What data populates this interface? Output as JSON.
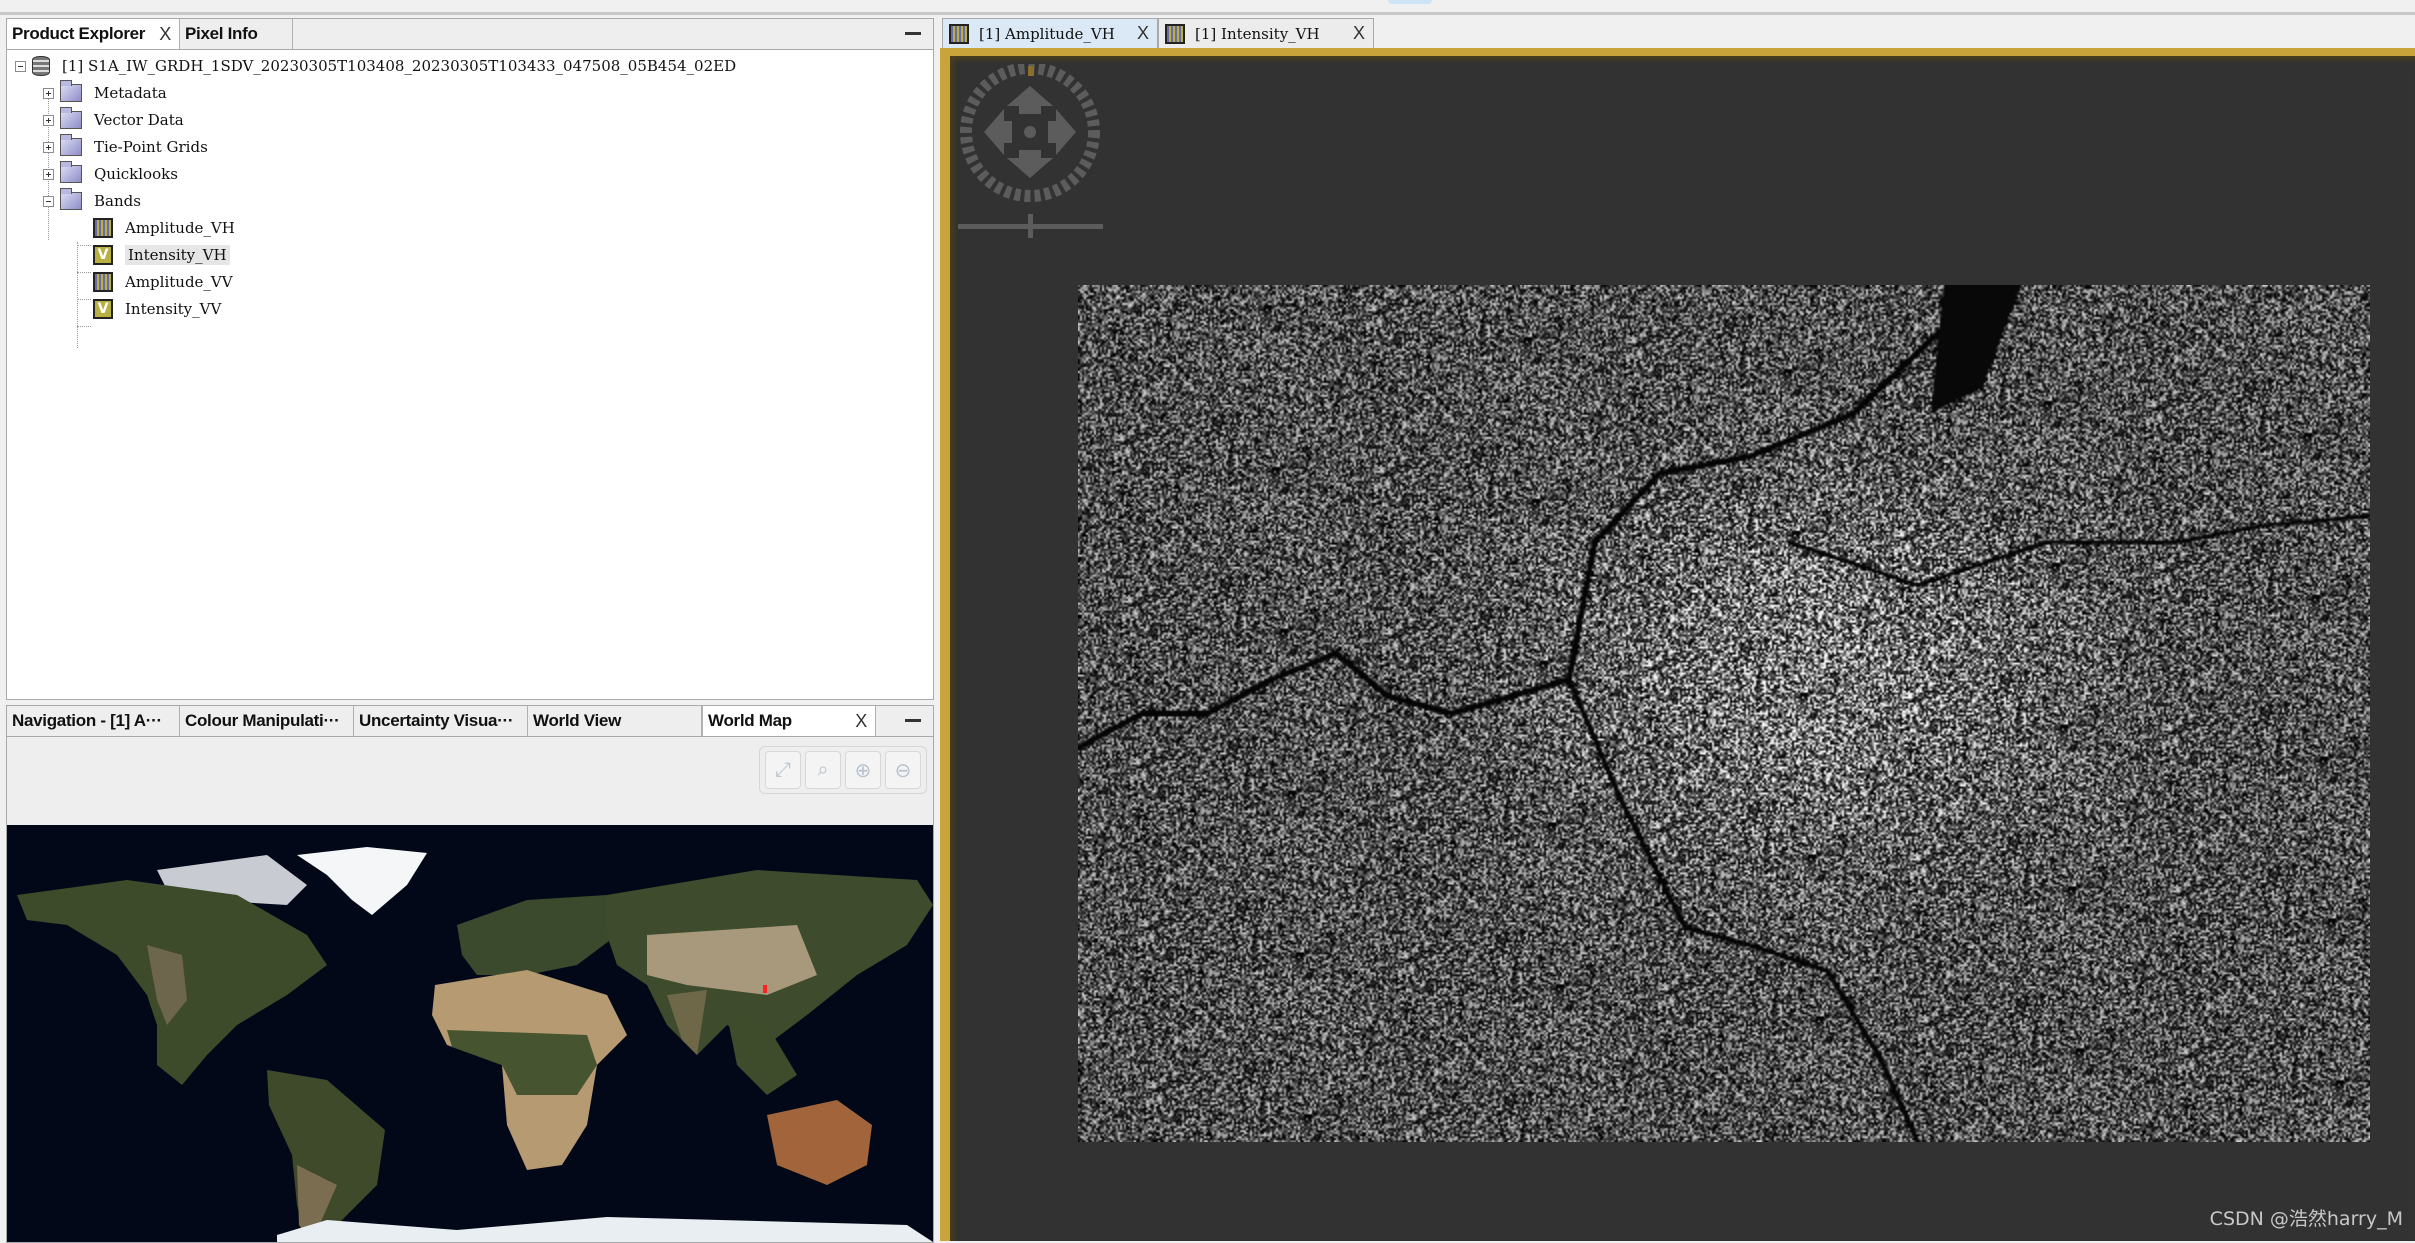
{
  "product_explorer": {
    "tabs": [
      {
        "label": "Product Explorer",
        "closable": true,
        "active": true
      },
      {
        "label": "Pixel Info",
        "closable": false,
        "active": false
      }
    ],
    "tree": {
      "product": {
        "label": "[1]  S1A_IW_GRDH_1SDV_20230305T103408_20230305T103433_047508_05B454_02ED",
        "icon": "database-icon",
        "expanded": true
      },
      "groups": [
        {
          "label": "Metadata",
          "icon": "folder-icon",
          "expanded": false
        },
        {
          "label": "Vector Data",
          "icon": "folder-icon",
          "expanded": false
        },
        {
          "label": "Tie-Point Grids",
          "icon": "folder-icon",
          "expanded": false
        },
        {
          "label": "Quicklooks",
          "icon": "folder-icon",
          "expanded": false
        },
        {
          "label": "Bands",
          "icon": "folder-open-icon",
          "expanded": true
        }
      ],
      "bands": [
        {
          "label": "Amplitude_VH",
          "icon": "band-icon",
          "selected": false
        },
        {
          "label": "Intensity_VH",
          "icon": "virtual-band-icon",
          "virtual_mark": "V",
          "selected": true
        },
        {
          "label": "Amplitude_VV",
          "icon": "band-icon",
          "selected": false
        },
        {
          "label": "Intensity_VV",
          "icon": "virtual-band-icon",
          "virtual_mark": "V",
          "selected": false
        }
      ]
    }
  },
  "bottom_panel": {
    "tabs": [
      {
        "label": "Navigation - [1] A···",
        "active": false
      },
      {
        "label": "Colour Manipulati···",
        "active": false
      },
      {
        "label": "Uncertainty Visua···",
        "active": false
      },
      {
        "label": "World View",
        "active": false
      },
      {
        "label": "World Map",
        "active": true,
        "closable": true
      }
    ],
    "toolbar": [
      {
        "name": "zoom-all",
        "icon": "fit-extent-icon",
        "glyph": "⤢"
      },
      {
        "name": "zoom-to-product",
        "icon": "zoom-selected-icon",
        "glyph": "⌕"
      },
      {
        "name": "zoom-in",
        "icon": "zoom-in-icon",
        "glyph": "⊕"
      },
      {
        "name": "zoom-out",
        "icon": "zoom-out-icon",
        "glyph": "⊖"
      }
    ],
    "world_map": {
      "product_footprint_color": "#ff2020"
    }
  },
  "image_view": {
    "tabs": [
      {
        "label": "[1] Amplitude_VH",
        "active": true
      },
      {
        "label": "[1] Intensity_VH",
        "active": false
      }
    ],
    "border_color": "#c9a43a",
    "background_color": "#323232",
    "image_band": "Amplitude_VH"
  },
  "close_glyph": "X",
  "watermark": "CSDN @浩然harry_M"
}
